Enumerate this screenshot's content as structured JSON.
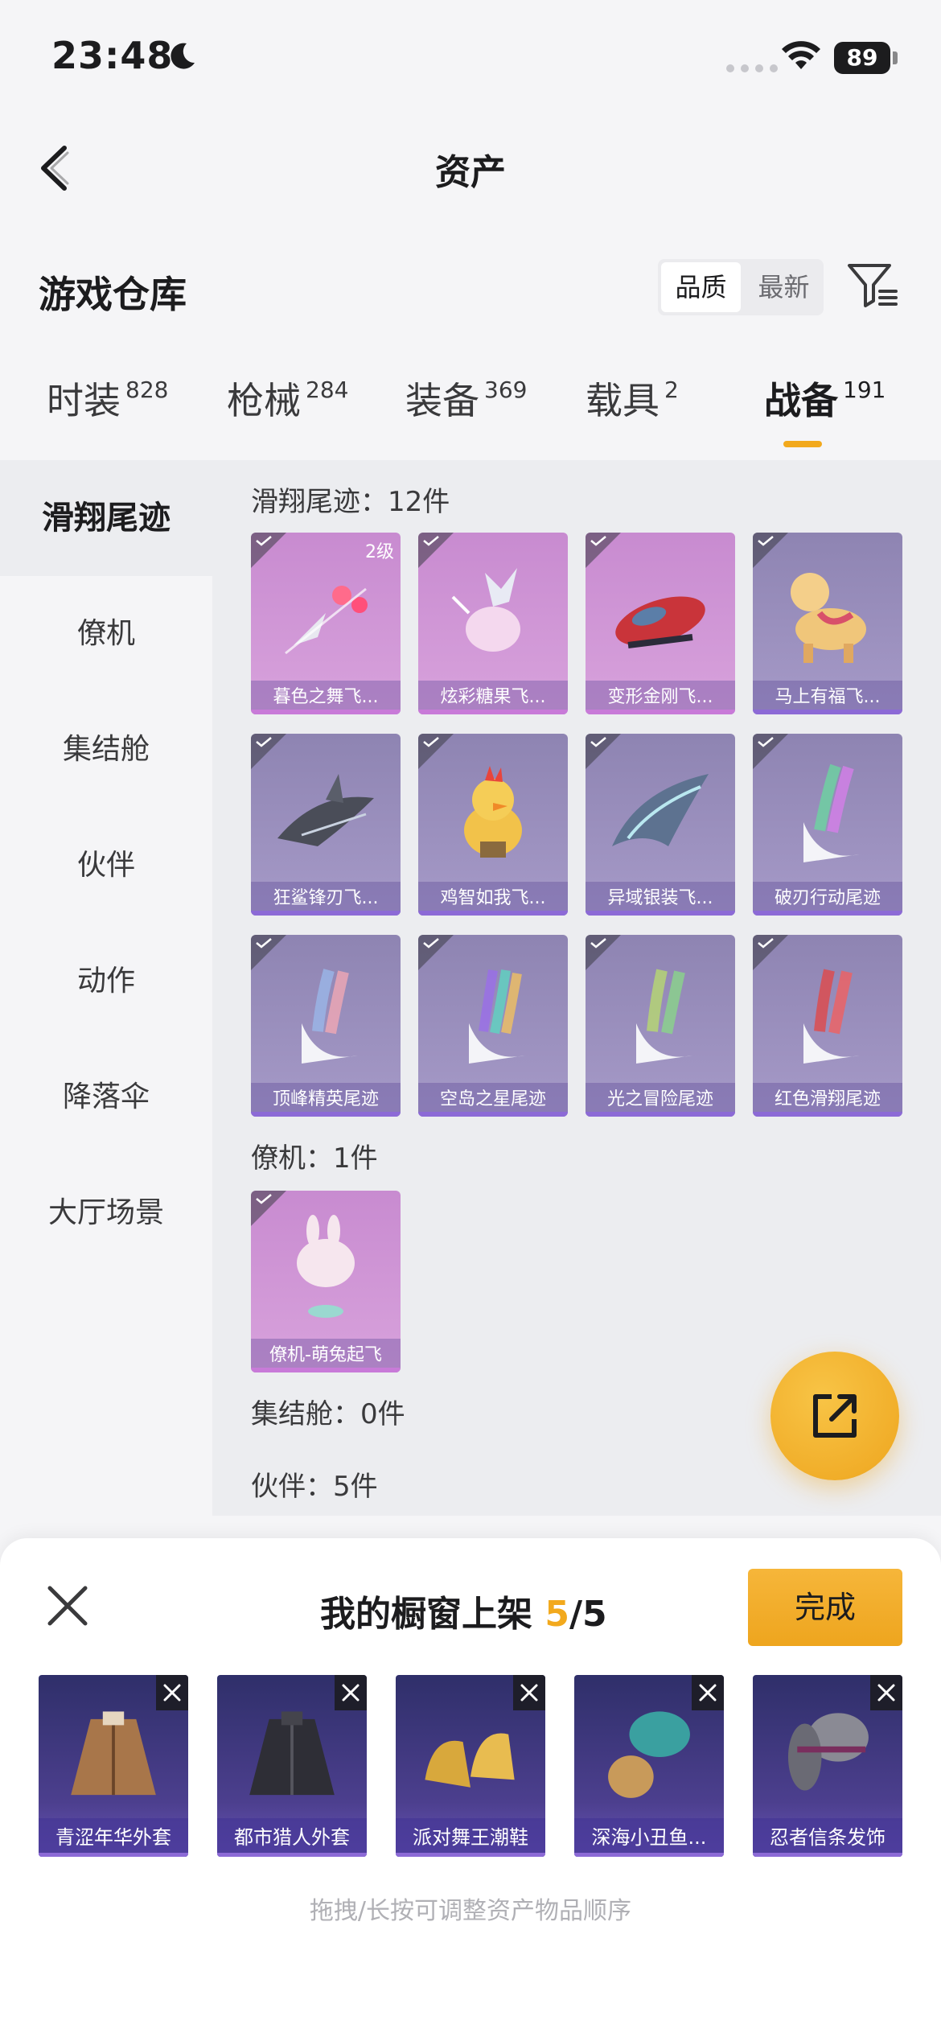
{
  "status_bar": {
    "time": "23:48",
    "battery": "89"
  },
  "nav": {
    "title": "资产"
  },
  "header": {
    "section_title": "游戏仓库",
    "sort_options": [
      "品质",
      "最新"
    ],
    "active_sort": "品质"
  },
  "tabs": [
    {
      "label": "时装",
      "count": "828"
    },
    {
      "label": "枪械",
      "count": "284"
    },
    {
      "label": "装备",
      "count": "369"
    },
    {
      "label": "载具",
      "count": "2"
    },
    {
      "label": "战备",
      "count": "191",
      "active": true
    }
  ],
  "sidebar": [
    {
      "label": "滑翔尾迹",
      "active": true
    },
    {
      "label": "僚机"
    },
    {
      "label": "集结舱"
    },
    {
      "label": "伙伴"
    },
    {
      "label": "动作"
    },
    {
      "label": "降落伞"
    },
    {
      "label": "大厅场景"
    }
  ],
  "groups": [
    {
      "label": "滑翔尾迹：12件"
    },
    {
      "label": "僚机：1件"
    },
    {
      "label": "集结舱：0件"
    },
    {
      "label": "伙伴：5件"
    }
  ],
  "items": [
    {
      "name": "暮色之舞飞...",
      "level": "2级",
      "rarity": "pink",
      "art": "trail-sparks"
    },
    {
      "name": "炫彩糖果飞...",
      "rarity": "pink",
      "art": "candy"
    },
    {
      "name": "变形金刚飞...",
      "rarity": "pink",
      "art": "jet"
    },
    {
      "name": "马上有福飞...",
      "rarity": "purple",
      "art": "horse"
    },
    {
      "name": "狂鲨锋刃飞...",
      "rarity": "purple",
      "art": "shark"
    },
    {
      "name": "鸡智如我飞...",
      "rarity": "purple",
      "art": "chicken"
    },
    {
      "name": "异域银装飞...",
      "rarity": "purple",
      "art": "wing"
    },
    {
      "name": "破刃行动尾迹",
      "rarity": "purple",
      "art": "smoke-rainbow"
    },
    {
      "name": "顶峰精英尾迹",
      "rarity": "purple",
      "art": "smoke-pastel"
    },
    {
      "name": "空岛之星尾迹",
      "rarity": "purple",
      "art": "smoke-multi"
    },
    {
      "name": "光之冒险尾迹",
      "rarity": "purple",
      "art": "smoke-green"
    },
    {
      "name": "红色滑翔尾迹",
      "rarity": "purple",
      "art": "smoke-red"
    }
  ],
  "wingman_items": [
    {
      "name": "僚机-萌兔起飞",
      "rarity": "pink",
      "art": "bunny"
    }
  ],
  "sheet": {
    "title": "我的橱窗上架",
    "current": "5",
    "total": "/5",
    "done_label": "完成",
    "hint": "拖拽/长按可调整资产物品顺序",
    "items": [
      {
        "name": "青涩年华外套",
        "art": "coat-tan"
      },
      {
        "name": "都市猎人外套",
        "art": "coat-black"
      },
      {
        "name": "派对舞王潮鞋",
        "art": "shoes-gold"
      },
      {
        "name": "深海小丑鱼...",
        "art": "hair-teal"
      },
      {
        "name": "忍者信条发饰",
        "art": "hair-gray"
      }
    ]
  },
  "colors": {
    "accent": "#f2a91d",
    "pink_rarity": "#c88bd0",
    "purple_rarity": "#8e84b2"
  }
}
